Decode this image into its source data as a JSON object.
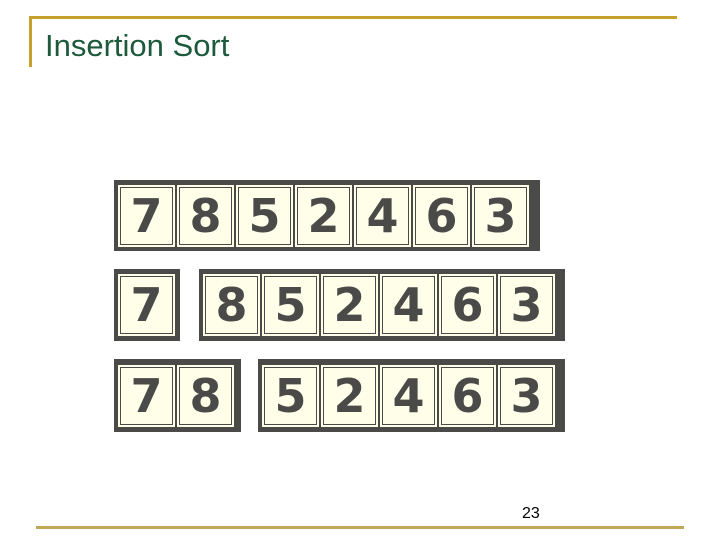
{
  "slide": {
    "title": "Insertion Sort",
    "page_number": "23"
  },
  "rows": [
    {
      "groups": [
        {
          "tiles": [
            "7",
            "8",
            "5",
            "2",
            "4",
            "6",
            "3"
          ]
        }
      ]
    },
    {
      "groups": [
        {
          "tiles": [
            "7"
          ]
        },
        {
          "tiles": [
            "8",
            "5",
            "2",
            "4",
            "6",
            "3"
          ]
        }
      ]
    },
    {
      "groups": [
        {
          "tiles": [
            "7",
            "8"
          ]
        },
        {
          "tiles": [
            "5",
            "2",
            "4",
            "6",
            "3"
          ]
        }
      ]
    }
  ],
  "colors": {
    "title": "#1d5a3c",
    "accent_frame": "#c7a02c",
    "tile_border": "#4a4a48",
    "tile_fill": "#fefee9"
  }
}
